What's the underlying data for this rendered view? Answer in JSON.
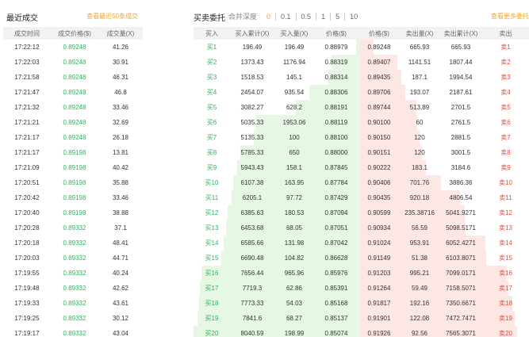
{
  "trades": {
    "title": "最近成交",
    "more_link": "查看最近50条成交",
    "headers": [
      "成交时间",
      "成交价格($)",
      "成交量(X)"
    ],
    "rows": [
      [
        "17:22:12",
        "0.89248",
        "41.26"
      ],
      [
        "17:22:03",
        "0.89248",
        "30.91"
      ],
      [
        "17:21:58",
        "0.89248",
        "46.31"
      ],
      [
        "17:21:47",
        "0.89248",
        "46.8"
      ],
      [
        "17:21:32",
        "0.89248",
        "33.46"
      ],
      [
        "17:21:21",
        "0.89248",
        "32.69"
      ],
      [
        "17:21:17",
        "0.89248",
        "26.18"
      ],
      [
        "17:21:17",
        "0.89198",
        "13.81"
      ],
      [
        "17:21:09",
        "0.89198",
        "40.42"
      ],
      [
        "17:20:51",
        "0.89198",
        "35.88"
      ],
      [
        "17:20:42",
        "0.89198",
        "33.46"
      ],
      [
        "17:20:40",
        "0.89198",
        "38.88"
      ],
      [
        "17:20:28",
        "0.89332",
        "37.1"
      ],
      [
        "17:20:18",
        "0.89332",
        "48.41"
      ],
      [
        "17:20:03",
        "0.89332",
        "44.71"
      ],
      [
        "17:19:55",
        "0.89332",
        "40.24"
      ],
      [
        "17:19:48",
        "0.89332",
        "42.62"
      ],
      [
        "17:19:33",
        "0.89332",
        "43.61"
      ],
      [
        "17:19:25",
        "0.89332",
        "30.12"
      ],
      [
        "17:19:17",
        "0.89332",
        "43.04"
      ]
    ]
  },
  "orderbook": {
    "title": "买卖委托",
    "depth_label": "合并深度",
    "depth_options": [
      "0",
      "0.1",
      "0.5",
      "1",
      "5",
      "10"
    ],
    "depth_active": "0",
    "more_link": "查看更多委托",
    "headers": [
      "买入",
      "买入累计(X)",
      "买入量(X)",
      "价格($)",
      "价格($)",
      "卖出量(X)",
      "卖出累计(X)",
      "卖出"
    ],
    "rows": [
      [
        "买1",
        "196.49",
        "196.49",
        "0.88979",
        "0.89248",
        "665.93",
        "665.93",
        "卖1"
      ],
      [
        "买2",
        "1373.43",
        "1176.94",
        "0.88319",
        "0.89407",
        "1141.51",
        "1807.44",
        "卖2"
      ],
      [
        "买3",
        "1518.53",
        "145.1",
        "0.88314",
        "0.89435",
        "187.1",
        "1994.54",
        "卖3"
      ],
      [
        "买4",
        "2454.07",
        "935.54",
        "0.88306",
        "0.89706",
        "193.07",
        "2187.61",
        "卖4"
      ],
      [
        "买5",
        "3082.27",
        "628.2",
        "0.88191",
        "0.89744",
        "513.89",
        "2701.5",
        "卖5"
      ],
      [
        "买6",
        "5035.33",
        "1953.06",
        "0.88119",
        "0.90100",
        "60",
        "2761.5",
        "卖6"
      ],
      [
        "买7",
        "5135.33",
        "100",
        "0.88100",
        "0.90150",
        "120",
        "2881.5",
        "卖7"
      ],
      [
        "买8",
        "5785.33",
        "650",
        "0.88000",
        "0.90151",
        "120",
        "3001.5",
        "卖8"
      ],
      [
        "买9",
        "5943.43",
        "158.1",
        "0.87845",
        "0.90222",
        "183.1",
        "3184.6",
        "卖9"
      ],
      [
        "买10",
        "6107.38",
        "163.95",
        "0.87784",
        "0.90406",
        "701.76",
        "3886.36",
        "卖10"
      ],
      [
        "买11",
        "6205.1",
        "97.72",
        "0.87429",
        "0.90435",
        "920.18",
        "4806.54",
        "卖11"
      ],
      [
        "买12",
        "6385.63",
        "180.53",
        "0.87094",
        "0.90599",
        "235.38716",
        "5041.9271",
        "卖12"
      ],
      [
        "买13",
        "6453.68",
        "68.05",
        "0.87051",
        "0.90934",
        "56.59",
        "5098.5171",
        "卖13"
      ],
      [
        "买14",
        "6585.66",
        "131.98",
        "0.87042",
        "0.91024",
        "953.91",
        "6052.4271",
        "卖14"
      ],
      [
        "买15",
        "6690.48",
        "104.82",
        "0.86628",
        "0.91149",
        "51.38",
        "6103.8071",
        "卖15"
      ],
      [
        "买16",
        "7656.44",
        "965.96",
        "0.85976",
        "0.91203",
        "995.21",
        "7099.0171",
        "卖16"
      ],
      [
        "买17",
        "7719.3",
        "62.86",
        "0.85391",
        "0.91264",
        "59.49",
        "7158.5071",
        "卖17"
      ],
      [
        "买18",
        "7773.33",
        "54.03",
        "0.85168",
        "0.91817",
        "192.16",
        "7350.6671",
        "卖18"
      ],
      [
        "买19",
        "7841.6",
        "68.27",
        "0.85137",
        "0.91901",
        "122.08",
        "7472.7471",
        "卖19"
      ],
      [
        "买20",
        "8040.59",
        "198.99",
        "0.85074",
        "0.91926",
        "92.56",
        "7565.3071",
        "卖20"
      ]
    ]
  },
  "colors": {
    "buy": "#2fb45a",
    "sell": "#e8463c",
    "accent": "#f5a623",
    "buy_depth": "#e6f7e4",
    "sell_depth": "#fde7e4"
  }
}
